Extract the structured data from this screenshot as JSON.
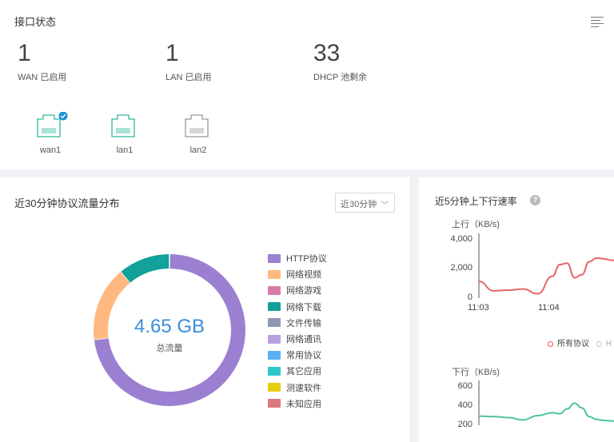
{
  "interface": {
    "title": "接口状态",
    "stats": [
      {
        "value": "1",
        "label": "WAN 已启用"
      },
      {
        "value": "1",
        "label": "LAN 已启用"
      },
      {
        "value": "33",
        "label": "DHCP 池剩余"
      }
    ],
    "ports": [
      {
        "name": "wan1",
        "status": "active-checked"
      },
      {
        "name": "lan1",
        "status": "active"
      },
      {
        "name": "lan2",
        "status": "inactive"
      }
    ]
  },
  "protocol": {
    "title": "近30分钟协议流量分布",
    "range_select": "近30分钟",
    "total_value": "4.65 GB",
    "total_label": "总流量",
    "legend": [
      {
        "label": "HTTP协议",
        "color": "#9b7fd1"
      },
      {
        "label": "网络视频",
        "color": "#ffb980"
      },
      {
        "label": "网络游戏",
        "color": "#d87aaa"
      },
      {
        "label": "网络下载",
        "color": "#12a19b"
      },
      {
        "label": "文件传输",
        "color": "#8d98b3"
      },
      {
        "label": "网络通讯",
        "color": "#b6a2de"
      },
      {
        "label": "常用协议",
        "color": "#5ab1ef"
      },
      {
        "label": "其它应用",
        "color": "#2ec7c9"
      },
      {
        "label": "测速软件",
        "color": "#e5cf0d"
      },
      {
        "label": "未知应用",
        "color": "#d87a80"
      }
    ]
  },
  "rate": {
    "title": "近5分钟上下行速率",
    "legend": [
      {
        "label": "所有协议"
      },
      {
        "label": "H"
      }
    ]
  },
  "chart_data": [
    {
      "type": "pie",
      "title": "近30分钟协议流量分布",
      "categories": [
        "HTTP协议",
        "网络视频",
        "网络下载"
      ],
      "values": [
        73,
        16,
        11
      ],
      "unit": "%"
    },
    {
      "type": "line",
      "title": "上行",
      "ylabel": "上行（KB/s)",
      "yticks": [
        "4,000",
        "2,000",
        "0"
      ],
      "ylim": [
        0,
        4000
      ],
      "xticks": [
        "11:03",
        "11:04"
      ],
      "x": [
        0,
        0.1,
        0.2,
        0.3,
        0.4,
        0.5,
        0.55,
        0.6,
        0.65,
        0.7,
        0.75,
        0.8,
        0.85,
        0.9,
        0.95,
        1.0
      ],
      "series": [
        {
          "name": "所有协议",
          "color": "#e8636b",
          "values": [
            1150,
            500,
            550,
            620,
            300,
            1500,
            2300,
            2400,
            1400,
            1600,
            2500,
            2750,
            2700,
            2600,
            2550,
            2500
          ]
        }
      ]
    },
    {
      "type": "line",
      "title": "下行",
      "ylabel": "下行（KB/s)",
      "yticks": [
        "600",
        "400",
        "200"
      ],
      "ylim": [
        200,
        600
      ],
      "x": [
        0,
        0.1,
        0.2,
        0.3,
        0.4,
        0.5,
        0.55,
        0.6,
        0.65,
        0.7,
        0.75,
        0.8,
        0.85,
        0.9,
        0.95,
        1.0
      ],
      "series": [
        {
          "name": "所有协议",
          "color": "#4fc3a1",
          "values": [
            295,
            290,
            280,
            255,
            300,
            330,
            320,
            370,
            430,
            380,
            290,
            260,
            250,
            245,
            240,
            240
          ]
        }
      ]
    }
  ]
}
